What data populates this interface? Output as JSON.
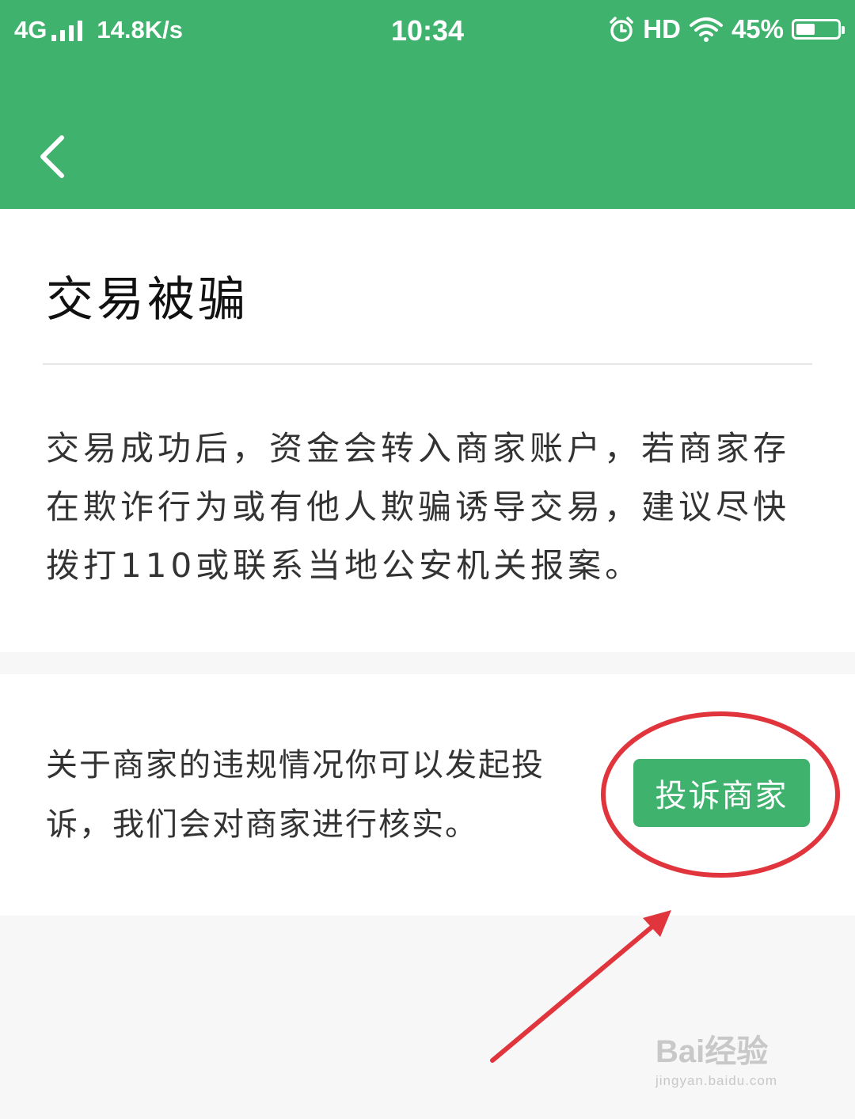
{
  "status_bar": {
    "network": "4G",
    "speed": "14.8K/s",
    "time": "10:34",
    "hd": "HD",
    "battery_percent": "45%",
    "battery_level": 0.45,
    "icons": [
      "signal-icon",
      "alarm-icon",
      "wifi-icon",
      "battery-icon"
    ]
  },
  "header": {
    "background_color": "#3fb26e",
    "back_icon": "chevron-left-icon"
  },
  "section1": {
    "title": "交易被骗",
    "body": "交易成功后，资金会转入商家账户，若商家存在欺诈行为或有他人欺骗诱导交易，建议尽快拨打110或联系当地公安机关报案。"
  },
  "section2": {
    "text": "关于商家的违规情况你可以发起投诉，我们会对商家进行核实。",
    "button_label": "投诉商家",
    "button_color": "#3fb26e"
  },
  "annotation": {
    "color": "#e0353d"
  },
  "watermark": {
    "main": "Bai经验",
    "sub": "jingyan.baidu.com"
  }
}
